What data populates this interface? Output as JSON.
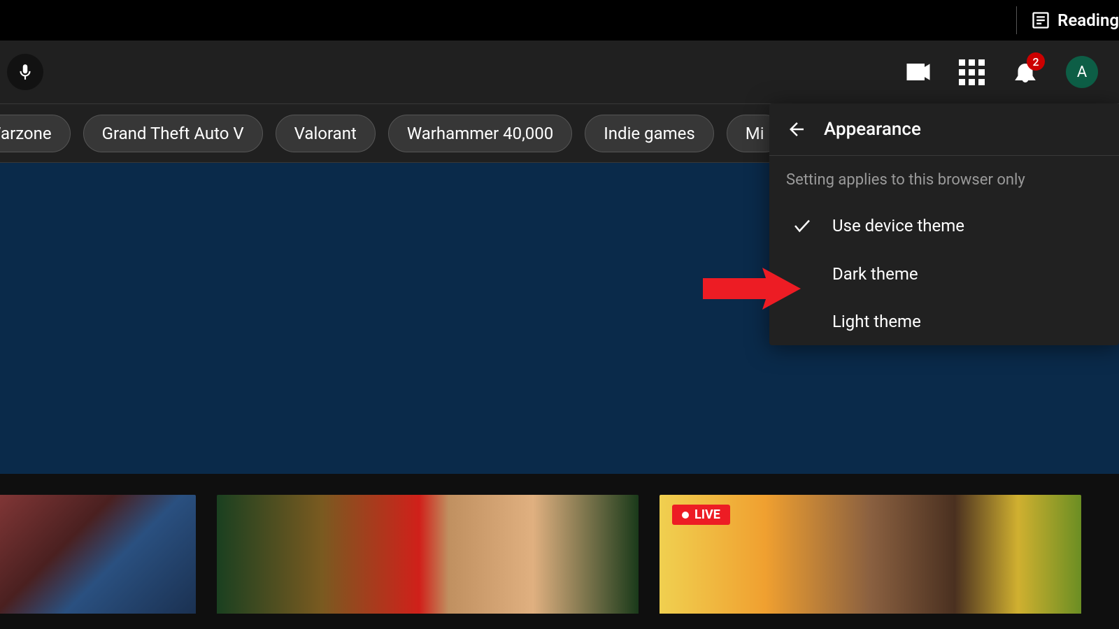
{
  "browser": {
    "reading_label": "Reading"
  },
  "header": {
    "notification_count": "2",
    "avatar_initial": "A"
  },
  "chips": [
    "y: Warzone",
    "Grand Theft Auto V",
    "Valorant",
    "Warhammer 40,000",
    "Indie games",
    "Mi"
  ],
  "menu": {
    "title": "Appearance",
    "subtitle": "Setting applies to this browser only",
    "items": [
      {
        "label": "Use device theme",
        "selected": true
      },
      {
        "label": "Dark theme",
        "selected": false
      },
      {
        "label": "Light theme",
        "selected": false
      }
    ]
  },
  "videos": {
    "live_label": "LIVE"
  }
}
